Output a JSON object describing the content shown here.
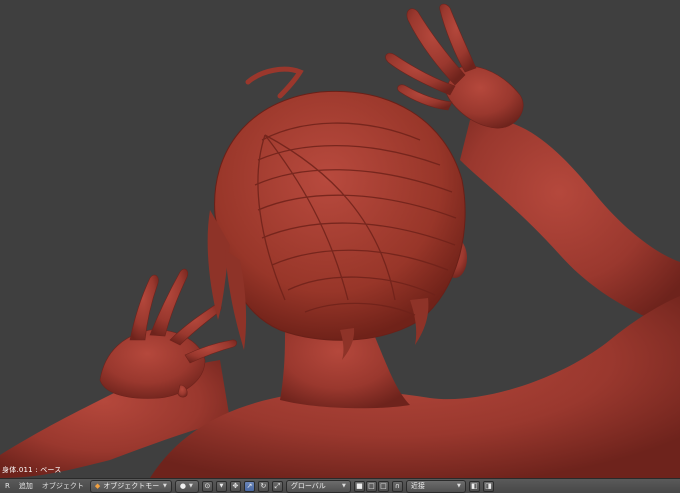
{
  "viewport": {
    "object_info": "身体.011 : ベース",
    "model_color": "#9b3a30",
    "background_color": "#3f3f3f"
  },
  "header": {
    "editor_type_label": "R",
    "menus": [
      "追加",
      "オブジェクト"
    ],
    "mode": "オブジェクトモード",
    "transform_orientation": "グローバル",
    "snap_target": "近接"
  },
  "icons": {
    "editor": "view3d-icon",
    "mode": "object-mode-icon",
    "shading": "solid-shading-icon",
    "pivot": "pivot-point-icon",
    "manipulator": "manipulator-icon",
    "translate": "translate-icon",
    "rotate": "rotate-icon",
    "scale": "scale-icon",
    "layers": "layer-icon",
    "snap": "magnet-icon",
    "render": "render-camera-icon"
  }
}
